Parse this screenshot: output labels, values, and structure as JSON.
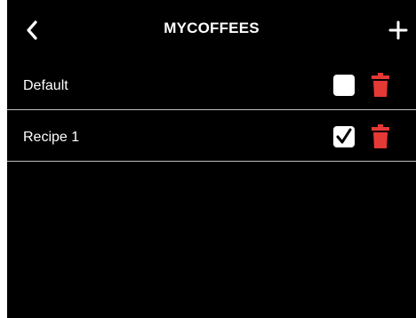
{
  "header": {
    "title": "MYCOFFEES",
    "back_icon": "chevron-left-icon",
    "add_icon": "plus-icon"
  },
  "recipes": [
    {
      "label": "Default",
      "checked": false
    },
    {
      "label": "Recipe 1",
      "checked": true
    }
  ],
  "colors": {
    "background": "#000000",
    "text": "#ffffff",
    "delete": "#e53935",
    "divider": "#bdbdbd"
  }
}
